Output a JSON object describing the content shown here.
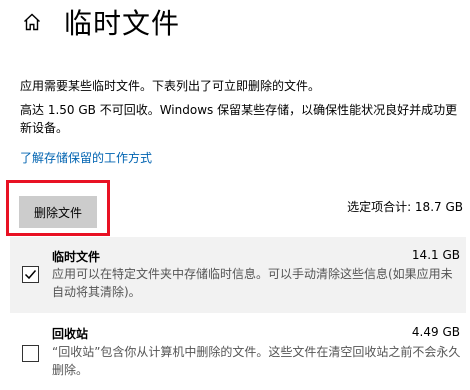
{
  "page": {
    "title": "临时文件",
    "description": "应用需要某些临时文件。下表列出了可立即删除的文件。",
    "reserved_info": "高达 1.50 GB 不可回收。Windows 保留某些存储，以确保性能状况良好并成功更新设备。",
    "learn_link": "了解存储保留的工作方式",
    "highlight_color": "#e81123",
    "link_color": "#0063b1"
  },
  "actions": {
    "delete_label": "删除文件",
    "selected_total": "选定项合计: 18.7 GB"
  },
  "items": [
    {
      "name": "临时文件",
      "size": "14.1 GB",
      "description": "应用可以在特定文件夹中存储临时信息。可以手动清除这些信息(如果应用未自动将其清除)。",
      "checked": true
    },
    {
      "name": "回收站",
      "size": "4.49 GB",
      "description": "“回收站”包含你从计算机中删除的文件。这些文件在清空回收站之前不会永久删除。",
      "checked": false
    }
  ]
}
